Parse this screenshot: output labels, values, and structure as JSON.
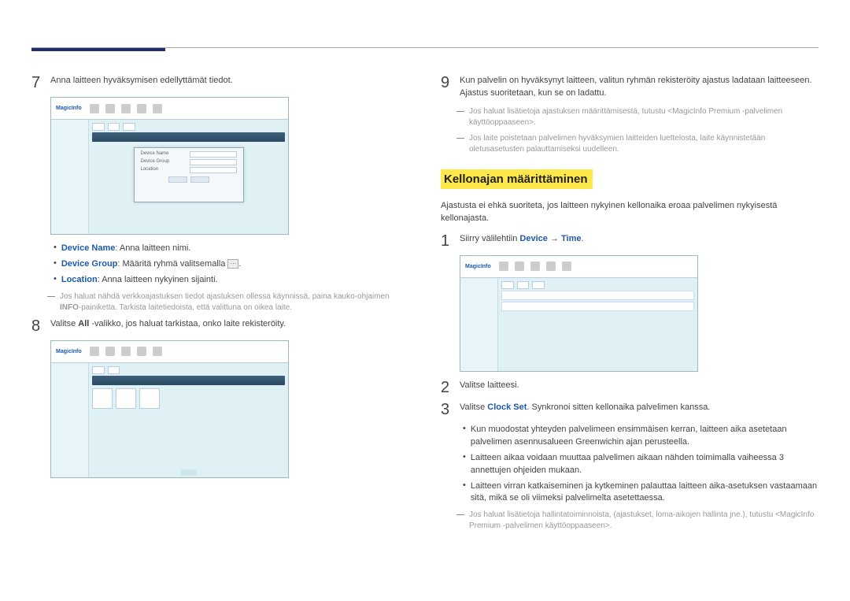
{
  "left": {
    "step7": {
      "num": "7",
      "text": "Anna laitteen hyväksymisen edellyttämät tiedot."
    },
    "bullets": {
      "device_name_label": "Device Name",
      "device_name_text": ": Anna laitteen nimi.",
      "device_group_label": "Device Group",
      "device_group_text": ": Määritä ryhmä valitsemalla ",
      "device_group_after": ".",
      "location_label": "Location",
      "location_text": ": Anna laitteen nykyinen sijainti."
    },
    "note1_a": "Jos haluat nähdä verkkoajastuksen tiedot ajastuksen ollessa käynnissä, paina kauko-ohjaimen ",
    "note1_b": "INFO",
    "note1_c": "-painiketta. Tarkista laitetiedoista, että valittuna on oikea laite.",
    "step8": {
      "num": "8",
      "text_a": "Valitse ",
      "text_b": "All",
      "text_c": " -valikko, jos haluat tarkistaa, onko laite rekisteröity."
    },
    "mock": {
      "logo": "MagicInfo"
    }
  },
  "right": {
    "step9": {
      "num": "9",
      "text": "Kun palvelin on hyväksynyt laitteen, valitun ryhmän rekisteröity ajastus ladataan laitteeseen. Ajastus suoritetaan, kun se on ladattu."
    },
    "note_a": "Jos haluat lisätietoja ajastuksen määrittämisestä, tutustu <MagicInfo Premium -palvelimen käyttöoppaaseen>.",
    "note_b": "Jos laite poistetaan palvelimen hyväksymien laitteiden luettelosta, laite käynnistetään oletusasetusten palauttamiseksi uudelleen.",
    "heading": "Kellonajan määrittäminen",
    "intro": "Ajastusta ei ehkä suoriteta, jos laitteen nykyinen kellonaika eroaa palvelimen nykyisestä kellonajasta.",
    "step1": {
      "num": "1",
      "a": "Siirry välilehtiin ",
      "b": "Device",
      "arrow": " → ",
      "c": "Time",
      "d": "."
    },
    "step2": {
      "num": "2",
      "text": "Valitse laitteesi."
    },
    "step3": {
      "num": "3",
      "a": "Valitse ",
      "b": "Clock Set",
      "c": ". Synkronoi sitten kellonaika palvelimen kanssa."
    },
    "sub1": "Kun muodostat yhteyden palvelimeen ensimmäisen kerran, laitteen aika asetetaan palvelimen asennusalueen Greenwichin ajan perusteella.",
    "sub2": "Laitteen aikaa voidaan muuttaa palvelimen aikaan nähden toimimalla vaiheessa 3 annettujen ohjeiden mukaan.",
    "sub3": "Laitteen virran katkaiseminen ja kytkeminen palauttaa laitteen aika-asetuksen vastaamaan sitä, mikä se oli viimeksi palvelimelta asetettaessa.",
    "footnote": "Jos haluat lisätietoja hallintatoiminnoista, (ajastukset, loma-aikojen hallinta jne.), tutustu <MagicInfo Premium -palvelimen käyttöoppaaseen>."
  }
}
